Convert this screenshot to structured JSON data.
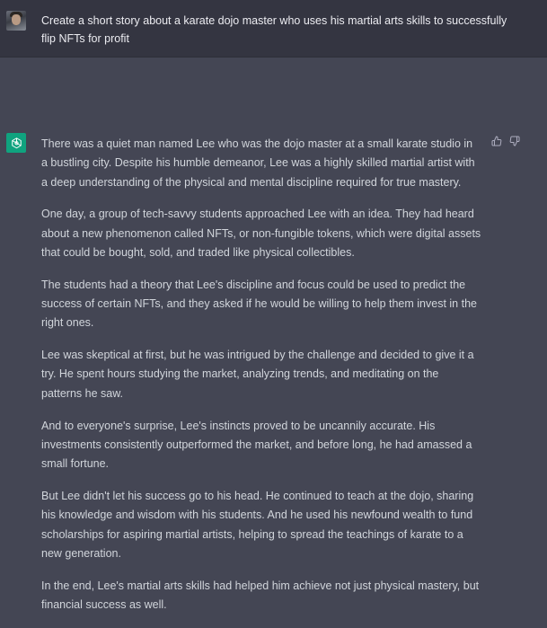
{
  "user_message": {
    "avatar": "user-avatar-photo",
    "text": "Create a short story about a karate dojo master who uses his martial arts skills to successfully flip NFTs for profit"
  },
  "assistant_message": {
    "icon": "openai-logo-icon",
    "feedback": {
      "thumbs_up": "thumbs-up-icon",
      "thumbs_down": "thumbs-down-icon"
    },
    "paragraphs": [
      "There was a quiet man named Lee who was the dojo master at a small karate studio in a bustling city. Despite his humble demeanor, Lee was a highly skilled martial artist with a deep understanding of the physical and mental discipline required for true mastery.",
      "One day, a group of tech-savvy students approached Lee with an idea. They had heard about a new phenomenon called NFTs, or non-fungible tokens, which were digital assets that could be bought, sold, and traded like physical collectibles.",
      "The students had a theory that Lee's discipline and focus could be used to predict the success of certain NFTs, and they asked if he would be willing to help them invest in the right ones.",
      "Lee was skeptical at first, but he was intrigued by the challenge and decided to give it a try. He spent hours studying the market, analyzing trends, and meditating on the patterns he saw.",
      "And to everyone's surprise, Lee's instincts proved to be uncannily accurate. His investments consistently outperformed the market, and before long, he had amassed a small fortune.",
      "But Lee didn't let his success go to his head. He continued to teach at the dojo, sharing his knowledge and wisdom with his students. And he used his newfound wealth to fund scholarships for aspiring martial artists, helping to spread the teachings of karate to a new generation.",
      "In the end, Lee's martial arts skills had helped him achieve not just physical mastery, but financial success as well."
    ]
  },
  "colors": {
    "user_bg": "#343541",
    "assistant_bg": "#444654",
    "text": "#d1d5db",
    "accent": "#10a37f"
  }
}
